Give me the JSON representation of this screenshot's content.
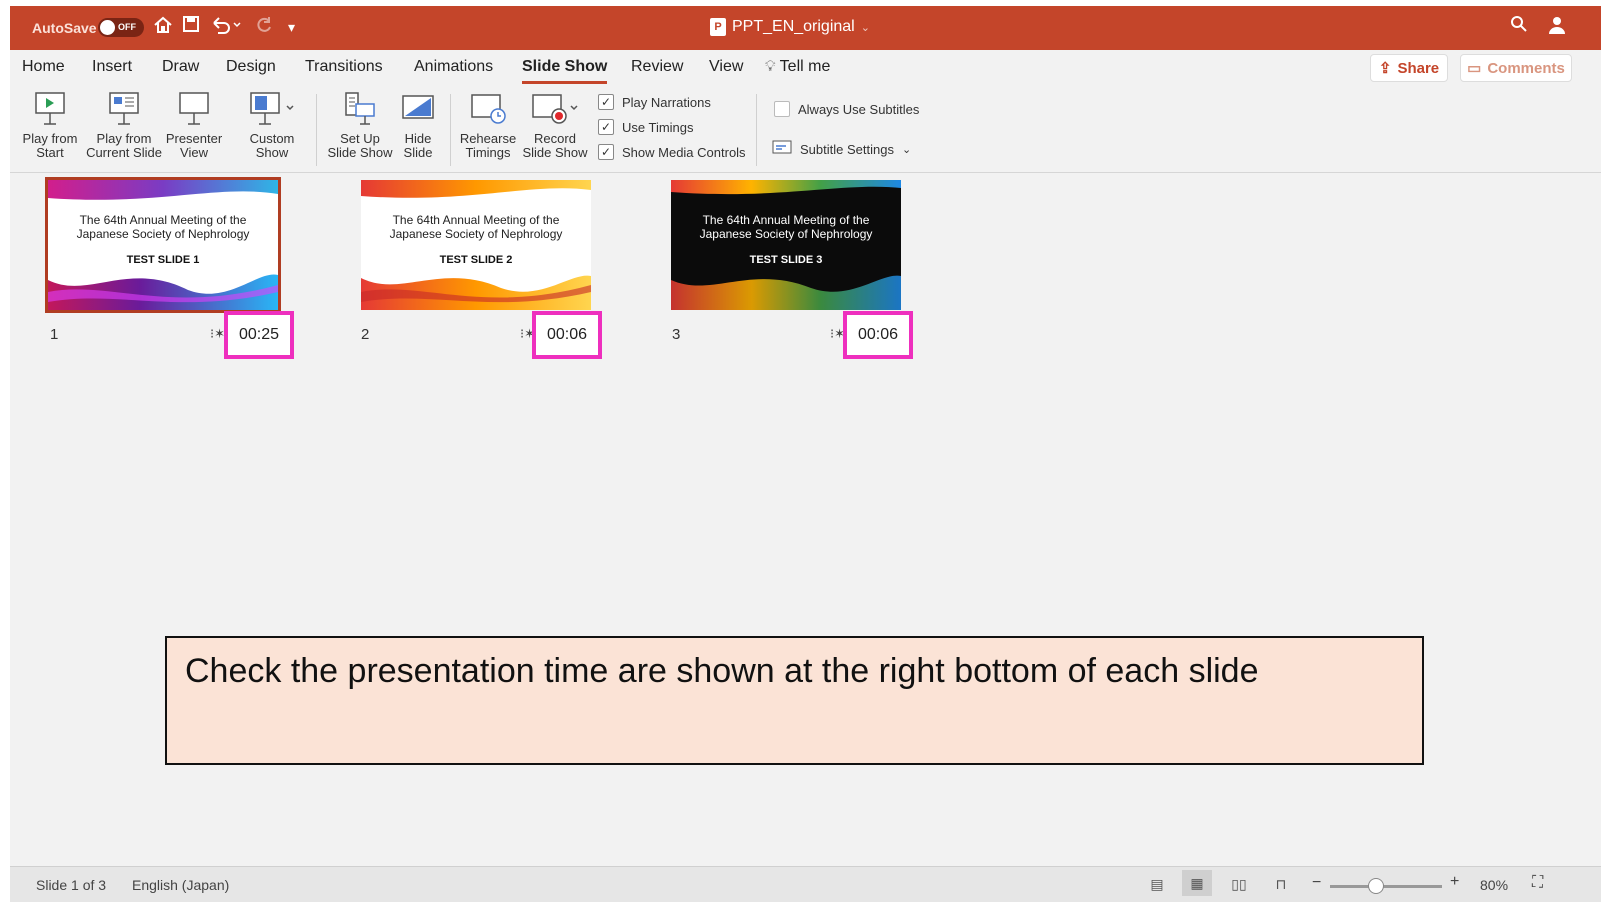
{
  "titlebar": {
    "autosave_label": "AutoSave",
    "autosave_state": "OFF",
    "document_title": "PPT_EN_original",
    "icons": [
      "home-icon",
      "save-icon",
      "undo-icon",
      "redo-icon",
      "customize-icon",
      "search-icon",
      "account-icon"
    ]
  },
  "tabs": [
    "Home",
    "Insert",
    "Draw",
    "Design",
    "Transitions",
    "Animations",
    "Slide Show",
    "Review",
    "View"
  ],
  "active_tab": "Slide Show",
  "tell_me": "Tell me",
  "share_label": "Share",
  "comments_label": "Comments",
  "ribbon": {
    "play_from_start": [
      "Play from",
      "Start"
    ],
    "play_from_current": [
      "Play from",
      "Current Slide"
    ],
    "presenter_view": [
      "Presenter",
      "View"
    ],
    "custom_show": [
      "Custom",
      "Show"
    ],
    "set_up": [
      "Set Up",
      "Slide Show"
    ],
    "hide_slide": [
      "Hide",
      "Slide"
    ],
    "rehearse": [
      "Rehearse",
      "Timings"
    ],
    "record": [
      "Record",
      "Slide Show"
    ],
    "play_narrations": "Play Narrations",
    "use_timings": "Use Timings",
    "show_media_controls": "Show Media Controls",
    "always_use_subtitles": "Always Use Subtitles",
    "subtitle_settings": "Subtitle Settings"
  },
  "slides": [
    {
      "number": "1",
      "title_line1": "The 64th Annual Meeting of the",
      "title_line2": "Japanese Society of Nephrology",
      "label": "TEST SLIDE 1",
      "time": "00:25"
    },
    {
      "number": "2",
      "title_line1": "The 64th Annual Meeting of the",
      "title_line2": "Japanese Society of Nephrology",
      "label": "TEST SLIDE 2",
      "time": "00:06"
    },
    {
      "number": "3",
      "title_line1": "The 64th Annual Meeting of the",
      "title_line2": "Japanese Society of Nephrology",
      "label": "TEST SLIDE 3",
      "time": "00:06"
    }
  ],
  "note": "Check the presentation time are shown at the right bottom of each slide",
  "status": {
    "slide_info": "Slide 1 of 3",
    "language": "English (Japan)",
    "zoom": "80%"
  },
  "colors": {
    "title_bar": "#c4452a",
    "highlight": "#ee2fbe",
    "note_bg": "#fbe3d6"
  }
}
